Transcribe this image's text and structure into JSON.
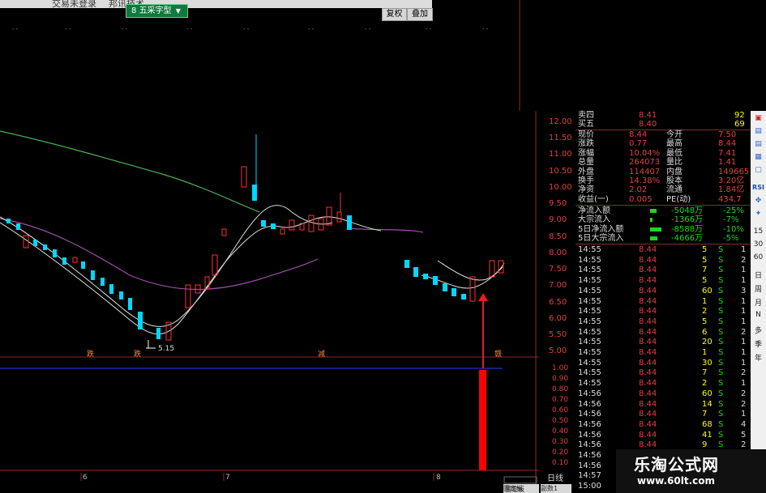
{
  "window": {
    "menu_left": "交易未登录",
    "menu_right": "邦讯技术"
  },
  "formula_tag": {
    "marker": "8",
    "label": "五采字型",
    "dropdown_icon": "chevron-down-icon"
  },
  "toolbar": {
    "restore_label": "复权",
    "overlay_label": "叠加"
  },
  "chart": {
    "price_axis_labels": [
      "12.00",
      "11.50",
      "11.00",
      "10.50",
      "10.00",
      "9.50",
      "9.00",
      "8.50",
      "8.00",
      "7.50",
      "7.00",
      "6.50",
      "6.00",
      "5.50",
      "5.00"
    ],
    "lower_axis_labels": [
      "1.00",
      "0.90",
      "0.80",
      "0.70",
      "0.60",
      "0.50",
      "0.40",
      "0.30",
      "0.20",
      "0.10"
    ],
    "low_marker": "5.15",
    "pattern_labels": [
      "跌",
      "跌",
      "减",
      "赣"
    ],
    "date_labels": [
      "6",
      "7",
      "8"
    ],
    "period_label": "日线",
    "bottom_tabs": [
      "固定板",
      "副数1"
    ],
    "lines": {
      "green": "#4caf50",
      "purple": "#9b4fa8",
      "white": "#e0e0e0"
    },
    "colors": {
      "up": "#ff3030",
      "down": "#00d8ff",
      "volume": "#ff0000"
    }
  },
  "quote": {
    "sell5": {
      "label": "卖四",
      "price": "8.41",
      "vol": "92"
    },
    "buy5": {
      "label": "买五",
      "price": "8.40",
      "vol": "69"
    },
    "stats": [
      {
        "l1": "现价",
        "v1": "8.44",
        "l2": "今开",
        "v2": "7.50"
      },
      {
        "l1": "涨跌",
        "v1": "0.77",
        "l2": "最高",
        "v2": "8.44"
      },
      {
        "l1": "涨幅",
        "v1": "10.04%",
        "l2": "最低",
        "v2": "7.41"
      },
      {
        "l1": "总量",
        "v1": "264073",
        "l2": "量比",
        "v2": "1.41"
      },
      {
        "l1": "外盘",
        "v1": "114407",
        "l2": "内盘",
        "v2": "149665"
      },
      {
        "l1": "换手",
        "v1": "14.38%",
        "l2": "股本",
        "v2": "3.20亿"
      },
      {
        "l1": "净资",
        "v1": "2.02",
        "l2": "流通",
        "v2": "1.84亿"
      },
      {
        "l1": "收益(一)",
        "v1": "0.005",
        "l2": "PE(动)",
        "v2": "434.7"
      }
    ],
    "flows": [
      {
        "label": "净流入额",
        "value": "-5048万",
        "pct": "-25%"
      },
      {
        "label": "大宗流入",
        "value": "-1366万",
        "pct": "-7%"
      },
      {
        "label": "5日净流入额",
        "value": "-8588万",
        "pct": "-10%"
      },
      {
        "label": "5日大宗流入",
        "value": "-4666万",
        "pct": "-5%"
      }
    ],
    "ticks": [
      {
        "t": "14:55",
        "p": "8.44",
        "v": "5",
        "s": "S",
        "n": "1"
      },
      {
        "t": "14:55",
        "p": "8.44",
        "v": "5",
        "s": "S",
        "n": "2"
      },
      {
        "t": "14:55",
        "p": "8.44",
        "v": "7",
        "s": "S",
        "n": "1"
      },
      {
        "t": "14:55",
        "p": "8.44",
        "v": "5",
        "s": "S",
        "n": "1"
      },
      {
        "t": "14:55",
        "p": "8.44",
        "v": "60",
        "s": "S",
        "n": "3"
      },
      {
        "t": "14:55",
        "p": "8.44",
        "v": "1",
        "s": "S",
        "n": "1"
      },
      {
        "t": "14:55",
        "p": "8.44",
        "v": "2",
        "s": "S",
        "n": "1"
      },
      {
        "t": "14:55",
        "p": "8.44",
        "v": "5",
        "s": "S",
        "n": "1"
      },
      {
        "t": "14:55",
        "p": "8.44",
        "v": "6",
        "s": "S",
        "n": "2"
      },
      {
        "t": "14:55",
        "p": "8.44",
        "v": "20",
        "s": "S",
        "n": "1"
      },
      {
        "t": "14:55",
        "p": "8.44",
        "v": "1",
        "s": "S",
        "n": "1"
      },
      {
        "t": "14:55",
        "p": "8.44",
        "v": "30",
        "s": "S",
        "n": "1"
      },
      {
        "t": "14:55",
        "p": "8.44",
        "v": "7",
        "s": "S",
        "n": "2"
      },
      {
        "t": "14:55",
        "p": "8.44",
        "v": "2",
        "s": "S",
        "n": "1"
      },
      {
        "t": "14:56",
        "p": "8.44",
        "v": "60",
        "s": "S",
        "n": "2"
      },
      {
        "t": "14:56",
        "p": "8.44",
        "v": "14",
        "s": "S",
        "n": "2"
      },
      {
        "t": "14:56",
        "p": "8.44",
        "v": "7",
        "s": "S",
        "n": "1"
      },
      {
        "t": "14:56",
        "p": "8.44",
        "v": "68",
        "s": "S",
        "n": "4"
      },
      {
        "t": "14:56",
        "p": "8.44",
        "v": "41",
        "s": "S",
        "n": "5"
      },
      {
        "t": "14:56",
        "p": "8.44",
        "v": "9",
        "s": "S",
        "n": "2"
      },
      {
        "t": "14:56",
        "p": "8.44",
        "v": "1",
        "s": "S",
        "n": "1"
      },
      {
        "t": "14:56",
        "p": "8.44",
        "v": "1",
        "s": "S",
        "n": "3"
      },
      {
        "t": "14:57",
        "p": "8.44",
        "v": "",
        "s": "",
        "n": ""
      },
      {
        "t": "15:00",
        "p": "",
        "v": "",
        "s": "",
        "n": ""
      }
    ]
  },
  "side_toolbar": {
    "items": [
      "RSI",
      "15",
      "30",
      "60",
      "日",
      "周",
      "月",
      "N",
      "多",
      "季",
      "年"
    ]
  },
  "watermark": {
    "title": "乐淘公式网",
    "url": "www.60lt.com"
  }
}
